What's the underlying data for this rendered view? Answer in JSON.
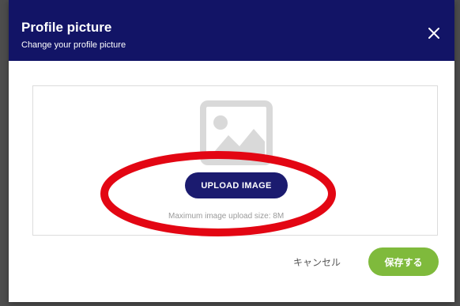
{
  "dialog": {
    "title": "Profile picture",
    "subtitle": "Change your profile picture",
    "close_icon": "close-icon"
  },
  "upload": {
    "placeholder_icon": "image-placeholder-icon",
    "button_label": "UPLOAD IMAGE",
    "hint": "Maximum image upload size: 8M"
  },
  "footer": {
    "cancel_label": "キャンセル",
    "save_label": "保存する"
  },
  "colors": {
    "header_bg": "#121466",
    "upload_button_bg": "#1b1b6f",
    "save_button_bg": "#7fba3c",
    "annotation_red": "#e30613"
  }
}
